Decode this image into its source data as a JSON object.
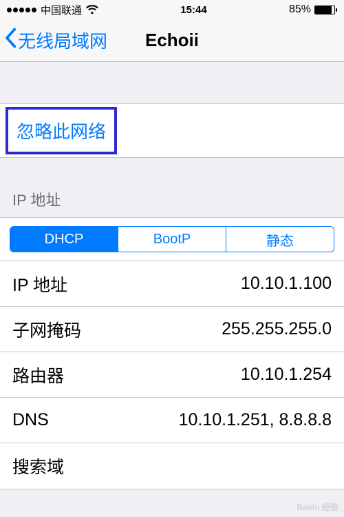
{
  "status": {
    "carrier": "中国联通",
    "time": "15:44",
    "battery_pct": "85%",
    "battery_fill_pct": 85
  },
  "nav": {
    "back_label": "无线局域网",
    "title": "Echoii"
  },
  "forget": {
    "label": "忽略此网络"
  },
  "section": {
    "ip_header": "IP 地址"
  },
  "segmented": {
    "items": [
      {
        "label": "DHCP",
        "active": true
      },
      {
        "label": "BootP",
        "active": false
      },
      {
        "label": "静态",
        "active": false
      }
    ]
  },
  "rows": [
    {
      "label": "IP 地址",
      "value": "10.10.1.100"
    },
    {
      "label": "子网掩码",
      "value": "255.255.255.0"
    },
    {
      "label": "路由器",
      "value": "10.10.1.254"
    },
    {
      "label": "DNS",
      "value": "10.10.1.251, 8.8.8.8"
    },
    {
      "label": "搜索域",
      "value": ""
    }
  ],
  "footer": {
    "watermark": "Baidu 经验"
  }
}
